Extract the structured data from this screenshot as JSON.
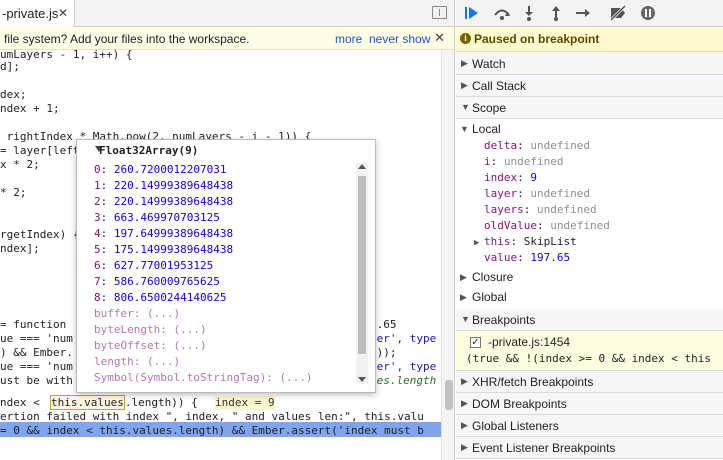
{
  "tab": {
    "filename": "-private.js",
    "close": "✕"
  },
  "infobar": {
    "message": "file system? Add your files into the workspace.",
    "more": "more",
    "never": "never show",
    "close": "✕"
  },
  "code": {
    "lines": [
      {
        "text": "umLayers - 1, i++) {"
      },
      {
        "text": "d];"
      },
      {
        "text": ""
      },
      {
        "text": "dex;"
      },
      {
        "text": "ndex + 1;"
      },
      {
        "text": ""
      },
      {
        "text": " rightIndex * Math.pow(2, numLayers - i - 1)) {"
      },
      {
        "text": "= layer[left"
      },
      {
        "text": "x * 2;"
      },
      {
        "text": ""
      },
      {
        "text": "* 2;"
      },
      {
        "text": ""
      },
      {
        "text": ""
      },
      {
        "text": "rgetIndex) {"
      },
      {
        "text": "ndex];"
      },
      {
        "text": ""
      },
      {
        "text": ""
      },
      {
        "text": ""
      },
      {
        "text": ""
      },
      {
        "text": "= function"
      },
      {
        "text": "ue === 'num"
      },
      {
        "text": ") && Ember."
      },
      {
        "text": "ue === 'num"
      },
      {
        "text": "ust be with"
      },
      {
        "text": ""
      },
      {
        "text": "ndex < "
      },
      {
        "text": "ertion failed with index \", index, \" and values len:\", this.valu"
      },
      {
        "text": "= 0 && index < this.values.length) && Ember.assert('index must b"
      }
    ],
    "right_fragments": [
      "7.65",
      "ber', type",
      "0));",
      "ber', type",
      "ues.length"
    ],
    "highlight_token": "this.values",
    "after_highlight": ".length)) {",
    "inline_value": "index = 9"
  },
  "popover": {
    "title": "Float32Array(9)",
    "items": [
      {
        "idx": "0",
        "val": "260.7200012207031"
      },
      {
        "idx": "1",
        "val": "220.14999389648438"
      },
      {
        "idx": "2",
        "val": "220.14999389648438"
      },
      {
        "idx": "3",
        "val": "663.469970703125"
      },
      {
        "idx": "4",
        "val": "197.64999389648438"
      },
      {
        "idx": "5",
        "val": "175.14999389648438"
      },
      {
        "idx": "6",
        "val": "627.77001953125"
      },
      {
        "idx": "7",
        "val": "586.760009765625"
      },
      {
        "idx": "8",
        "val": "806.6500244140625"
      }
    ],
    "props": [
      "buffer: (...)",
      "byteLength: (...)",
      "byteOffset: (...)",
      "length: (...)",
      "Symbol(Symbol.toStringTag): (...)"
    ]
  },
  "sidebar": {
    "paused": "Paused on breakpoint",
    "sections": {
      "watch": "Watch",
      "callstack": "Call Stack",
      "scope": "Scope",
      "closure": "Closure",
      "global": "Global",
      "breakpoints": "Breakpoints",
      "xhr": "XHR/fetch Breakpoints",
      "dom": "DOM Breakpoints",
      "listeners": "Global Listeners",
      "event": "Event Listener Breakpoints"
    },
    "local": {
      "label": "Local",
      "vars": [
        {
          "k": "delta",
          "v": "undefined",
          "t": "u"
        },
        {
          "k": "i",
          "v": "undefined",
          "t": "u"
        },
        {
          "k": "index",
          "v": "9",
          "t": "n"
        },
        {
          "k": "layer",
          "v": "undefined",
          "t": "u"
        },
        {
          "k": "layers",
          "v": "undefined",
          "t": "u"
        },
        {
          "k": "oldValue",
          "v": "undefined",
          "t": "u"
        },
        {
          "k": "this",
          "v": "SkipList",
          "t": "o"
        },
        {
          "k": "value",
          "v": "197.65",
          "t": "n"
        }
      ]
    },
    "breakpoint": {
      "file": "-private.js:1454",
      "expr": "(true && !(index >= 0 && index < this"
    }
  }
}
